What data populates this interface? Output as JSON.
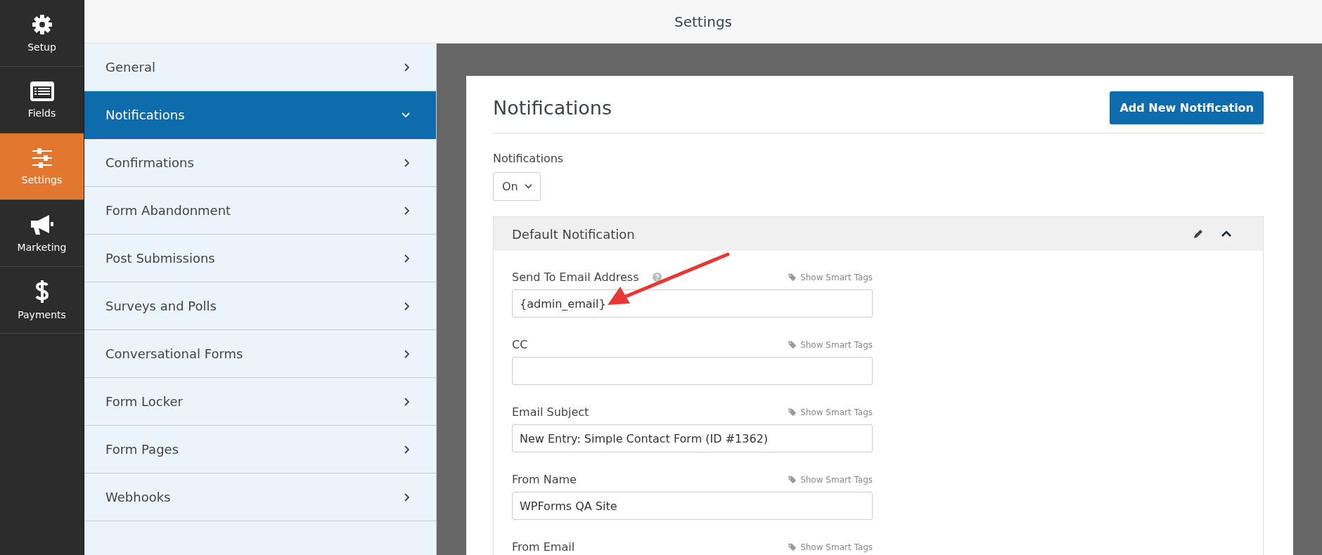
{
  "app_nav": [
    {
      "label": "Setup",
      "selected": false
    },
    {
      "label": "Fields",
      "selected": false
    },
    {
      "label": "Settings",
      "selected": true
    },
    {
      "label": "Marketing",
      "selected": false
    },
    {
      "label": "Payments",
      "selected": false
    }
  ],
  "header": {
    "title": "Settings"
  },
  "settings_menu": [
    {
      "label": "General",
      "selected": false
    },
    {
      "label": "Notifications",
      "selected": true
    },
    {
      "label": "Confirmations",
      "selected": false
    },
    {
      "label": "Form Abandonment",
      "selected": false
    },
    {
      "label": "Post Submissions",
      "selected": false
    },
    {
      "label": "Surveys and Polls",
      "selected": false
    },
    {
      "label": "Conversational Forms",
      "selected": false
    },
    {
      "label": "Form Locker",
      "selected": false
    },
    {
      "label": "Form Pages",
      "selected": false
    },
    {
      "label": "Webhooks",
      "selected": false
    }
  ],
  "panel": {
    "title": "Notifications",
    "add_button": "Add New Notification",
    "toggle": {
      "label": "Notifications",
      "value": "On"
    },
    "notification": {
      "title": "Default Notification",
      "expanded": true,
      "fields": [
        {
          "label": "Send To Email Address",
          "help": true,
          "smart_tags": "Show Smart Tags",
          "value": "{admin_email}"
        },
        {
          "label": "CC",
          "help": false,
          "smart_tags": "Show Smart Tags"
        },
        {
          "label": "Email Subject",
          "help": false,
          "smart_tags": "Show Smart Tags",
          "value": "New Entry: Simple Contact Form (ID #1362)"
        },
        {
          "label": "From Name",
          "help": false,
          "smart_tags": "Show Smart Tags",
          "value": "WPForms QA Site"
        },
        {
          "label": "From Email",
          "help": false,
          "smart_tags": "Show Smart Tags"
        }
      ]
    }
  }
}
